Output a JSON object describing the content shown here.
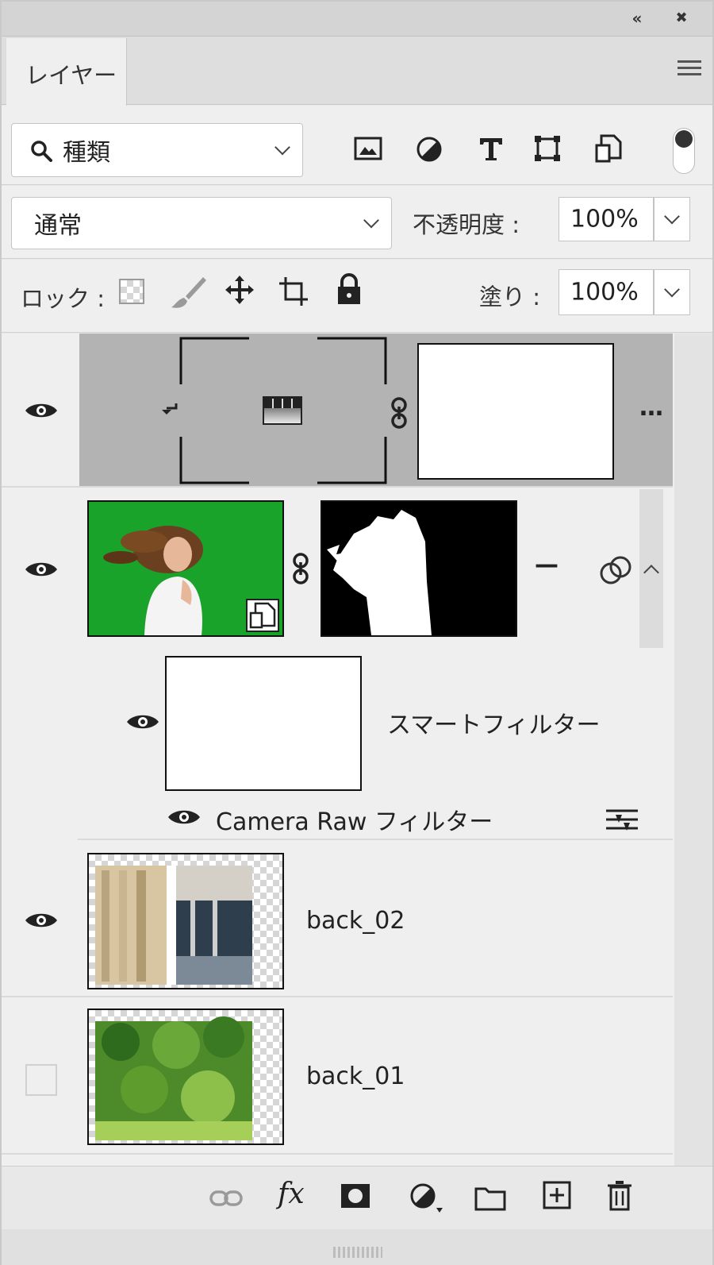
{
  "panel": {
    "tab_label": "レイヤー",
    "collapse_glyph": "«",
    "close_glyph": "✖"
  },
  "filter": {
    "kind_label": "種類",
    "icons": [
      "image-filter-icon",
      "adjustment-filter-icon",
      "type-filter-icon",
      "shape-filter-icon",
      "smart-object-filter-icon"
    ]
  },
  "blend": {
    "mode": "通常",
    "opacity_label": "不透明度 :",
    "opacity_value": "100%"
  },
  "lock": {
    "label": "ロック :",
    "fill_label": "塗り :",
    "fill_value": "100%",
    "icons": [
      "lock-transparent-icon",
      "lock-paint-icon",
      "lock-position-icon",
      "lock-artboard-icon",
      "lock-all-icon"
    ]
  },
  "layers": [
    {
      "id": "gradient-adjustment",
      "visible": true,
      "selected": true,
      "clipped": true,
      "name": "",
      "ellipsis": "…"
    },
    {
      "id": "model-smart-object",
      "visible": true,
      "name": "",
      "dash": "—",
      "expanded": true
    },
    {
      "id": "smart-filters",
      "visible": true,
      "name": "スマートフィルター"
    },
    {
      "id": "camera-raw",
      "visible": true,
      "name": "Camera Raw フィルター"
    },
    {
      "id": "back_02",
      "visible": true,
      "name": "back_02"
    },
    {
      "id": "back_01",
      "visible": false,
      "name": "back_01"
    }
  ],
  "bottom_toolbar": {
    "fx_label": "fx",
    "icons": [
      "link-layers-icon",
      "fx-icon",
      "add-mask-icon",
      "new-fill-adjustment-icon",
      "new-group-icon",
      "new-layer-icon",
      "delete-layer-icon"
    ]
  },
  "colors": {
    "selected_row": "#b3b3b3",
    "panel_bg": "#efefef",
    "green_screen": "#1aa32a"
  }
}
